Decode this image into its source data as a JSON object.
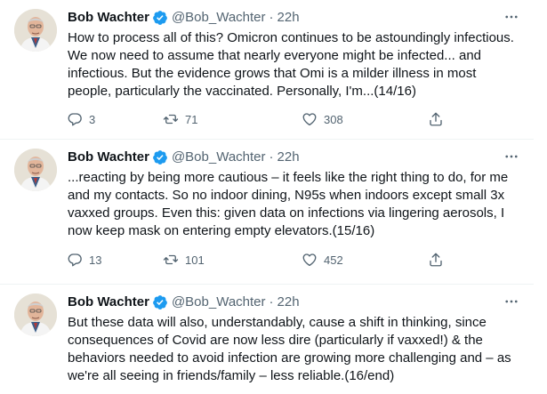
{
  "tweets": [
    {
      "name": "Bob Wachter",
      "handle": "@Bob_Wachter",
      "separator": "·",
      "time": "22h",
      "text": "How to process all of this? Omicron continues to be astoundingly infectious. We now need to assume that nearly everyone might be infected... and infectious. But the evidence grows that Omi is a milder illness in most people, particularly the vaccinated. Personally, I'm...(14/16)",
      "replies": "3",
      "retweets": "71",
      "likes": "308"
    },
    {
      "name": "Bob Wachter",
      "handle": "@Bob_Wachter",
      "separator": "·",
      "time": "22h",
      "text": "...reacting by being more cautious – it feels like the right thing to do, for me and my contacts. So no indoor dining, N95s when indoors except small 3x vaxxed groups. Even this: given data on infections via lingering aerosols, I now keep mask on entering empty elevators.(15/16)",
      "replies": "13",
      "retweets": "101",
      "likes": "452"
    },
    {
      "name": "Bob Wachter",
      "handle": "@Bob_Wachter",
      "separator": "·",
      "time": "22h",
      "text": "But these data will also, understandably, cause a shift in thinking, since consequences of Covid are now less dire (particularly if vaxxed!) & the behaviors needed to avoid infection are growing more challenging and – as we're all seeing in friends/family – less reliable.(16/end)"
    }
  ],
  "colors": {
    "text_primary": "#0f1419",
    "text_secondary": "#536471",
    "verified_blue": "#1d9bf0",
    "divider": "#eff3f4"
  },
  "icons": {
    "verified": "verified-badge-icon",
    "more": "more-dots-icon",
    "reply": "reply-icon",
    "retweet": "retweet-icon",
    "like": "heart-icon",
    "share": "share-icon"
  }
}
